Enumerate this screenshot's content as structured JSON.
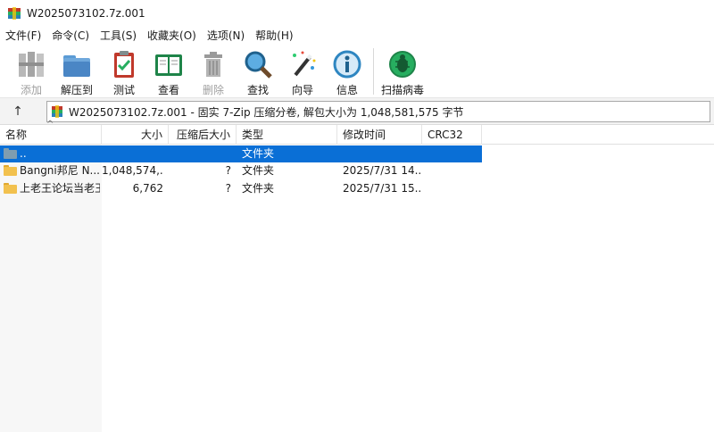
{
  "window": {
    "title": "W2025073102.7z.001"
  },
  "menu": [
    "文件(F)",
    "命令(C)",
    "工具(S)",
    "收藏夹(O)",
    "选项(N)",
    "帮助(H)"
  ],
  "toolbar": [
    {
      "label": "添加",
      "icon": "books-add-icon",
      "disabled": true
    },
    {
      "label": "解压到",
      "icon": "extract-folder-icon",
      "disabled": false
    },
    {
      "label": "测试",
      "icon": "test-clipboard-icon",
      "disabled": false
    },
    {
      "label": "查看",
      "icon": "view-book-icon",
      "disabled": false
    },
    {
      "label": "删除",
      "icon": "trash-icon",
      "disabled": true
    },
    {
      "label": "查找",
      "icon": "magnifier-icon",
      "disabled": false
    },
    {
      "label": "向导",
      "icon": "wizard-wand-icon",
      "disabled": false
    },
    {
      "label": "信息",
      "icon": "info-icon",
      "disabled": false
    },
    {
      "label": "扫描病毒",
      "icon": "virus-scan-icon",
      "disabled": false
    }
  ],
  "address": {
    "up_icon": "↑",
    "text": "W2025073102.7z.001 - 固实 7-Zip 压缩分卷, 解包大小为 1,048,581,575 字节"
  },
  "columns": {
    "sort_caret": "^",
    "name": "名称",
    "size": "大小",
    "packed": "压缩后大小",
    "type": "类型",
    "modified": "修改时间",
    "crc": "CRC32"
  },
  "rows": [
    {
      "name": "..",
      "size": "",
      "packed": "",
      "type": "文件夹",
      "modified": "",
      "selected": true,
      "icon_color": "#7f9db0"
    },
    {
      "name": "Bangni邦尼 N...",
      "size": "1,048,574,...",
      "packed": "?",
      "type": "文件夹",
      "modified": "2025/7/31 14...",
      "selected": false,
      "icon_color": "#f2c14e"
    },
    {
      "name": "上老王论坛当老王",
      "size": "6,762",
      "packed": "?",
      "type": "文件夹",
      "modified": "2025/7/31 15...",
      "selected": false,
      "icon_color": "#f2c14e"
    }
  ],
  "colors": {
    "selection": "#0a6fd6",
    "folder": "#f2c14e",
    "parent_folder": "#7f9db0"
  }
}
